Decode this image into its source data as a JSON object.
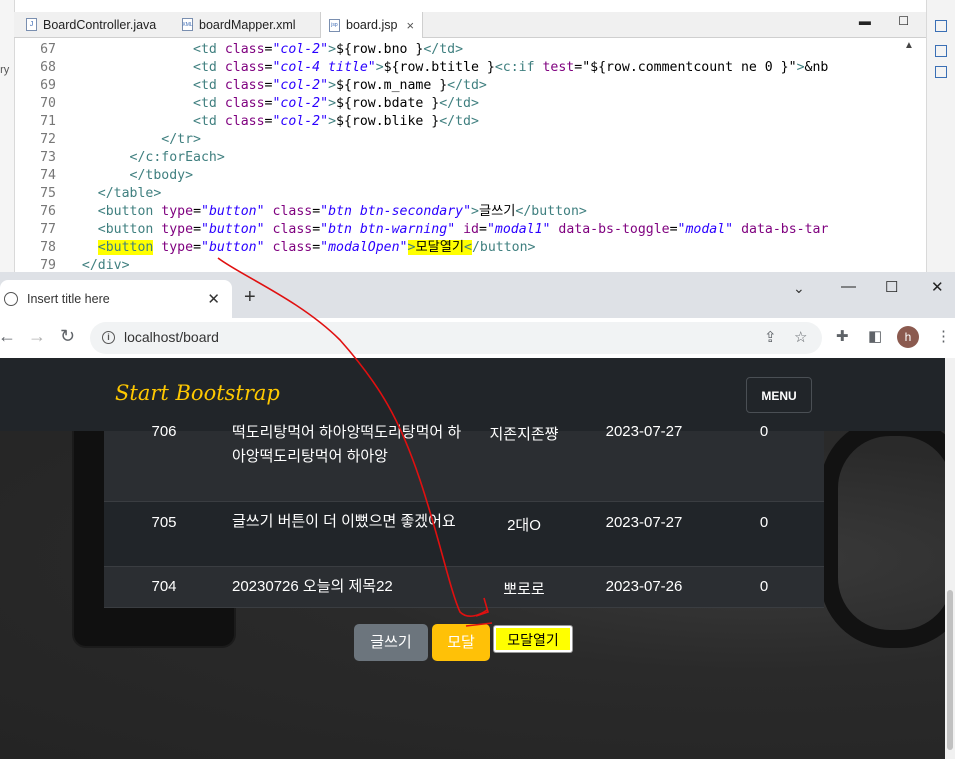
{
  "editor": {
    "left_panel_text": "ory",
    "tabs": [
      {
        "label": "BoardController.java",
        "icon": "J"
      },
      {
        "label": "boardMapper.xml",
        "icon": "XML"
      },
      {
        "label": "board.jsp",
        "icon": "jsp",
        "close": "×"
      }
    ],
    "line_numbers": [
      "67",
      "68",
      "69",
      "70",
      "71",
      "72",
      "73",
      "74",
      "75",
      "76",
      "77",
      "78",
      "79"
    ]
  },
  "browser": {
    "tab_title": "Insert title here",
    "tab_close": "✕",
    "new_tab": "+",
    "url": "localhost/board",
    "profile_initial": "h",
    "window_controls": {
      "minimize": "—",
      "maximize": "☐",
      "close": "✕"
    }
  },
  "page": {
    "brand": "Start Bootstrap",
    "menu_label": "MENU",
    "rows": [
      {
        "no": "706",
        "title": "떡도리탕먹어 하아앙떡도리탕먹어 하아앙떡도리탕먹어 하아앙",
        "name": "지존지존쨩",
        "date": "2023-07-27",
        "like": "0"
      },
      {
        "no": "705",
        "title": "글쓰기 버튼이 더 이뻤으면 좋겠어요",
        "name": "2대O",
        "date": "2023-07-27",
        "like": "0"
      },
      {
        "no": "704",
        "title": "20230726 오늘의 제목22",
        "name": "뽀로로",
        "date": "2023-07-26",
        "like": "0"
      }
    ],
    "buttons": {
      "write": "글쓰기",
      "modal": "모달",
      "modal_open": "모달열기"
    }
  },
  "colors": {
    "brand": "#ffc800",
    "navbar": "#212529",
    "secondary_button": "#6c757d",
    "warning_button": "#ffc107",
    "highlight": "#ffff00",
    "annotation": "#e01010"
  }
}
